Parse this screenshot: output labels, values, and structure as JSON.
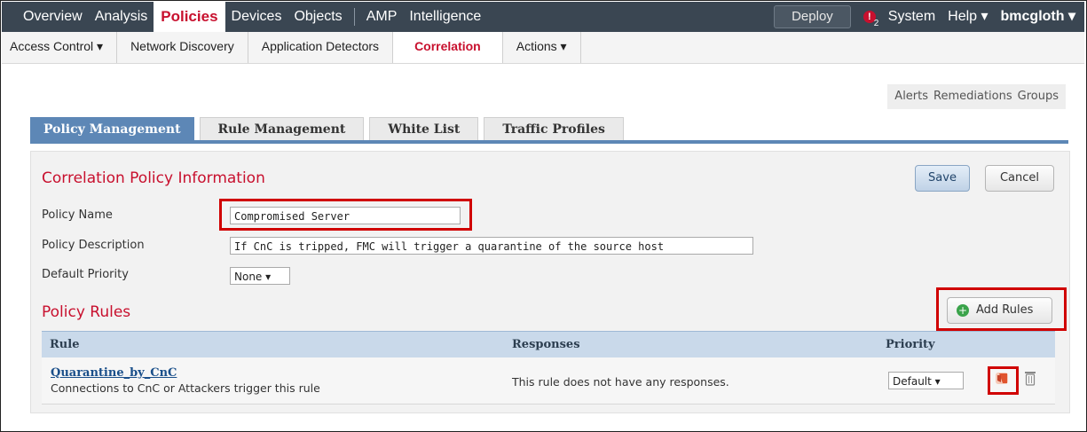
{
  "nav": {
    "items": [
      "Overview",
      "Analysis",
      "Policies",
      "Devices",
      "Objects",
      "AMP",
      "Intelligence"
    ],
    "deploy": "Deploy",
    "alert_count": "2",
    "system": "System",
    "help": "Help ▾",
    "user": "bmcgloth ▾"
  },
  "subnav": {
    "items": [
      "Access Control ▾",
      "Network Discovery",
      "Application Detectors",
      "Correlation",
      "Actions ▾"
    ]
  },
  "rightlinks": [
    "Alerts",
    "Remediations",
    "Groups"
  ],
  "tabs": [
    "Policy Management",
    "Rule Management",
    "White List",
    "Traffic Profiles"
  ],
  "info": {
    "title": "Correlation Policy Information",
    "save": "Save",
    "cancel": "Cancel",
    "name_label": "Policy Name",
    "name_value": "Compromised Server",
    "desc_label": "Policy Description",
    "desc_value": "If CnC is tripped, FMC will trigger a quarantine of the source host",
    "prio_label": "Default Priority",
    "prio_value": "None ▾"
  },
  "rules": {
    "title": "Policy Rules",
    "add": "Add Rules",
    "headers": [
      "Rule",
      "Responses",
      "Priority",
      ""
    ],
    "rows": [
      {
        "name": "Quarantine_by_CnC",
        "desc": "Connections to CnC or Attackers trigger this rule",
        "responses": "This rule does not have any responses.",
        "priority": "Default ▾"
      }
    ]
  },
  "colors": {
    "nav_bg": "#3a4652",
    "accent_red": "#c8102e",
    "tab_blue": "#5d87b6",
    "highlight": "#d00000"
  }
}
